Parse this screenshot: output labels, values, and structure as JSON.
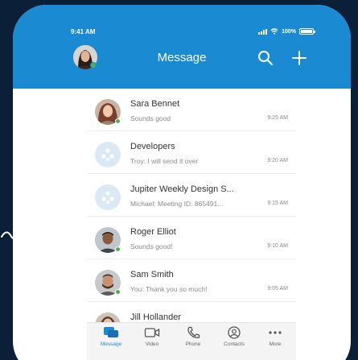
{
  "status_bar": {
    "time": "9:41 AM",
    "battery": "100%"
  },
  "header": {
    "title": "Message"
  },
  "colors": {
    "brand": "#1a8bd2",
    "background": "#0c1f38",
    "presence": "#4caf50"
  },
  "conversations": [
    {
      "name": "Sara Bennet",
      "snippet": "Sounds good",
      "time": "9:25 AM",
      "online": true,
      "avatar": "person-photo"
    },
    {
      "name": "Developers",
      "snippet": "Troy: I will send it over",
      "time": "9:20 AM",
      "online": false,
      "avatar": "group-icon"
    },
    {
      "name": "Jupiter Weekly Design S...",
      "snippet": "Michael: Meeting ID: 865491...",
      "time": "9:15 AM",
      "online": false,
      "avatar": "group-icon"
    },
    {
      "name": "Roger Elliot",
      "snippet": "Sounds good!",
      "time": "9:10 AM",
      "online": true,
      "avatar": "person-photo"
    },
    {
      "name": "Sam Smith",
      "snippet": "You: Thank you so much!",
      "time": "9:05 AM",
      "online": true,
      "avatar": "person-photo"
    },
    {
      "name": "Jill Hollander",
      "snippet": "",
      "time": "",
      "online": false,
      "avatar": "person-photo"
    }
  ],
  "tabs": [
    {
      "label": "Message",
      "icon": "message-icon",
      "active": true
    },
    {
      "label": "Video",
      "icon": "video-icon",
      "active": false
    },
    {
      "label": "Phone",
      "icon": "phone-icon",
      "active": false
    },
    {
      "label": "Contacts",
      "icon": "contacts-icon",
      "active": false
    },
    {
      "label": "More",
      "icon": "more-icon",
      "active": false
    }
  ]
}
